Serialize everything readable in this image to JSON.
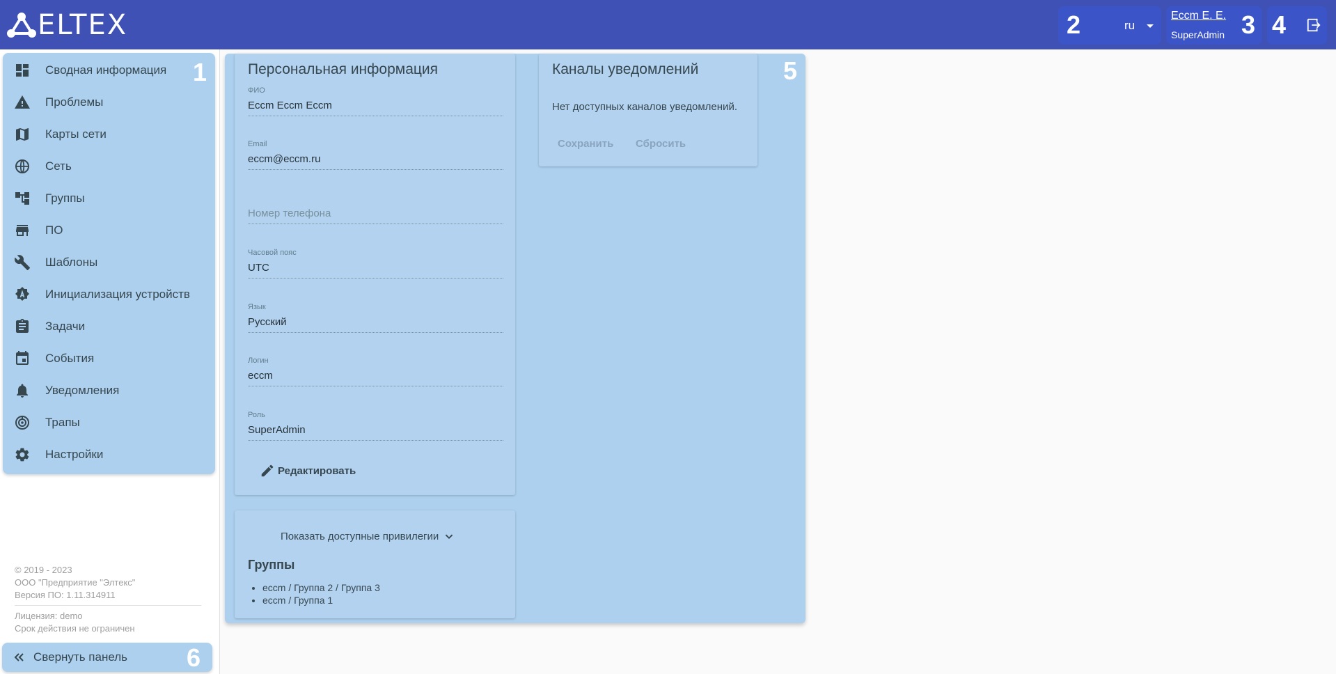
{
  "header": {
    "logo_text": "ELTEX",
    "lang": {
      "value": "ru",
      "marker": "2"
    },
    "user": {
      "name": "Eccm E. E.",
      "role": "SuperAdmin",
      "marker": "3"
    },
    "logout": {
      "marker": "4"
    },
    "colors": {
      "bar": "#3f51b5",
      "box": "#3b55c9"
    }
  },
  "sidebar": {
    "marker": "1",
    "items": [
      {
        "label": "Сводная информация",
        "icon": "dashboard-icon"
      },
      {
        "label": "Проблемы",
        "icon": "warning-icon"
      },
      {
        "label": "Карты сети",
        "icon": "map-icon"
      },
      {
        "label": "Сеть",
        "icon": "globe-icon"
      },
      {
        "label": "Группы",
        "icon": "hierarchy-icon"
      },
      {
        "label": "ПО",
        "icon": "store-icon"
      },
      {
        "label": "Шаблоны",
        "icon": "wrench-icon"
      },
      {
        "label": "Инициализация устройств",
        "icon": "auto-badge-icon"
      },
      {
        "label": "Задачи",
        "icon": "clipboard-icon"
      },
      {
        "label": "События",
        "icon": "calendar-icon"
      },
      {
        "label": "Уведомления",
        "icon": "bell-icon"
      },
      {
        "label": "Трапы",
        "icon": "target-icon"
      },
      {
        "label": "Настройки",
        "icon": "gear-icon"
      }
    ],
    "footer": {
      "copyright": "© 2019 - 2023",
      "company": "ООО \"Предприятие \"Элтекс\"",
      "version": "Версия ПО: 1.11.314911",
      "license": "Лицензия: demo",
      "expiry": "Срок действия не ограничен"
    },
    "collapse": {
      "label": "Свернуть панель",
      "marker": "6"
    }
  },
  "main": {
    "marker": "5",
    "personal": {
      "title": "Персональная информация",
      "fields": {
        "fio": {
          "label": "ФИО",
          "value": "Eccm Eccm Eccm"
        },
        "email": {
          "label": "Email",
          "value": "eccm@eccm.ru"
        },
        "phone": {
          "placeholder": "Номер телефона"
        },
        "timezone": {
          "label": "Часовой пояс",
          "value": "UTC"
        },
        "language": {
          "label": "Язык",
          "value": "Русский"
        },
        "login": {
          "label": "Логин",
          "value": "eccm"
        },
        "role": {
          "label": "Роль",
          "value": "SuperAdmin"
        }
      },
      "edit_label": "Редактировать"
    },
    "privileges": {
      "toggle_label": "Показать доступные привилегии",
      "groups_title": "Группы",
      "groups": [
        "eccm / Группа 2 / Группа 3",
        "eccm / Группа 1"
      ]
    },
    "notifications": {
      "title": "Каналы уведомлений",
      "empty_text": "Нет доступных каналов уведомлений.",
      "save_label": "Сохранить",
      "reset_label": "Сбросить"
    },
    "colors": {
      "panel": "#acd0ee",
      "card": "#b2d2f0"
    }
  }
}
